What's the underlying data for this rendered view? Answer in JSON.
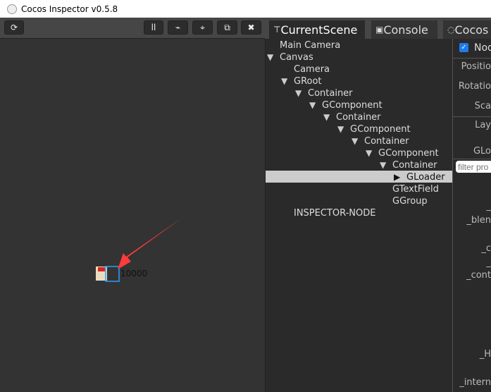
{
  "window": {
    "title": "Cocos Inspector v0.5.8"
  },
  "toolbar": {
    "refresh": "refresh-icon",
    "pause": "pause-icon",
    "stats": "chart-icon",
    "locate": "crosshair-icon",
    "rotate": "rotate-icon",
    "tools": "tools-icon"
  },
  "tabs": [
    {
      "label": "CurrentScene",
      "icon": "tree-icon"
    },
    {
      "label": "Console",
      "icon": "terminal-icon"
    },
    {
      "label": "Cocos",
      "icon": "flame-icon"
    }
  ],
  "scene": {
    "label": "10000",
    "arrow_color": "#ff3b3b",
    "selection_color": "#1e90ff"
  },
  "tree": [
    {
      "label": "Main Camera",
      "depth": 0,
      "arrow": ""
    },
    {
      "label": "Canvas",
      "depth": 0,
      "arrow": "down"
    },
    {
      "label": "Camera",
      "depth": 1,
      "arrow": ""
    },
    {
      "label": "GRoot",
      "depth": 1,
      "arrow": "down"
    },
    {
      "label": "Container",
      "depth": 2,
      "arrow": "down"
    },
    {
      "label": "GComponent",
      "depth": 3,
      "arrow": "down"
    },
    {
      "label": "Container",
      "depth": 4,
      "arrow": "down"
    },
    {
      "label": "GComponent",
      "depth": 5,
      "arrow": "down"
    },
    {
      "label": "Container",
      "depth": 6,
      "arrow": "down"
    },
    {
      "label": "GComponent",
      "depth": 7,
      "arrow": "down"
    },
    {
      "label": "Container",
      "depth": 8,
      "arrow": "down"
    },
    {
      "label": "GLoader",
      "depth": 9,
      "arrow": "right",
      "selected": true
    },
    {
      "label": "GTextField",
      "depth": 10,
      "arrow": ""
    },
    {
      "label": "GGroup",
      "depth": 10,
      "arrow": ""
    },
    {
      "label": "INSPECTOR-NODE",
      "depth": 1,
      "arrow": ""
    }
  ],
  "inspector": {
    "node_label": "Nod",
    "node_checked": true,
    "labels": [
      "Positio",
      "Rotatio",
      "Sca",
      "Lay",
      "GLo"
    ],
    "filter_placeholder": "filter pro",
    "props": [
      "_",
      "_blen",
      "_c",
      "_",
      "_cont",
      "_H",
      "_intern"
    ]
  }
}
